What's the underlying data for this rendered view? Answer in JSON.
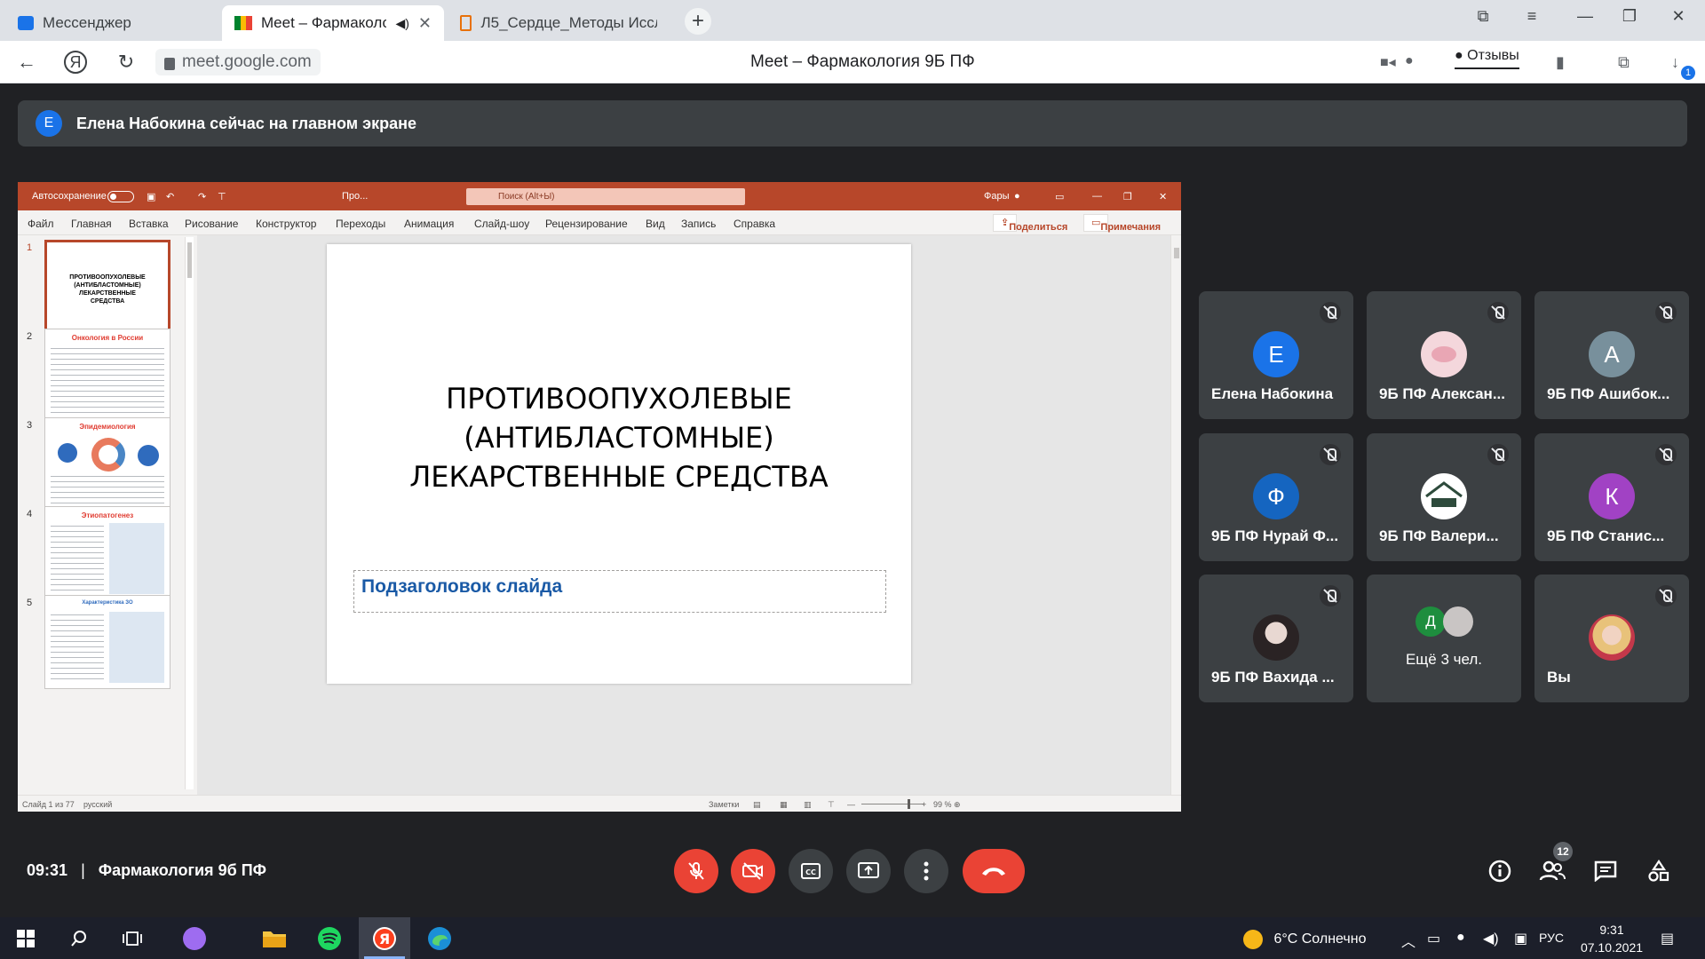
{
  "browser": {
    "tabs": [
      {
        "label": "Мессенджер"
      },
      {
        "label": "Meet – Фармакология 9Б ПФ"
      },
      {
        "label": "Л5_Сердце_Методы Иссле"
      }
    ],
    "url": "meet.google.com",
    "page_title": "Meet – Фармакология 9Б ПФ",
    "feedback_label": "Отзывы",
    "downloads_badge": "1"
  },
  "banner": {
    "avatar_letter": "Е",
    "text": "Елена Набокина сейчас на главном экране"
  },
  "presentation": {
    "app_bar": {
      "autosave": "Автосохранение",
      "file": "Про...",
      "search_placeholder": "Поиск (Alt+Ы)",
      "user": "Фары"
    },
    "menu": [
      "Файл",
      "Главная",
      "Вставка",
      "Рисование",
      "Конструктор",
      "Переходы",
      "Анимация",
      "Слайд-шоу",
      "Рецензирование",
      "Вид",
      "Запись",
      "Справка"
    ],
    "share_label": "Поделиться",
    "comments_label": "Примечания",
    "thumbnails": [
      {
        "num": "1",
        "text": "ПРОТИВООПУХОЛЕВЫЕ (АНТИБЛАСТОМНЫЕ) ЛЕКАРСТВЕННЫЕ СРЕДСТВА"
      },
      {
        "num": "2",
        "text": "Онкология в России"
      },
      {
        "num": "3",
        "text": "Эпидемиология"
      },
      {
        "num": "4",
        "text": "Этиопатогенез"
      },
      {
        "num": "5",
        "text": "Характеристика ЗО"
      }
    ],
    "slide": {
      "title": [
        "ПРОТИВООПУХОЛЕВЫЕ",
        "(АНТИБЛАСТОМНЫЕ)",
        "ЛЕКАРСТВЕННЫЕ СРЕДСТВА"
      ],
      "subtitle": "Подзаголовок слайда"
    },
    "status": {
      "slide_counter": "Слайд 1 из 77",
      "language": "русский",
      "notes": "Заметки",
      "zoom": "99 %"
    }
  },
  "participants": [
    {
      "name": "Елена Набокина",
      "letter": "Е",
      "color": "#1a73e8",
      "muted": true
    },
    {
      "name": "9Б ПФ Алексан...",
      "letter": "",
      "color": "#f4d7dc",
      "muted": true
    },
    {
      "name": "9Б ПФ Ашибок...",
      "letter": "А",
      "color": "#78909c",
      "muted": true
    },
    {
      "name": "9Б ПФ Нурай Ф...",
      "letter": "Ф",
      "color": "#1565c0",
      "muted": true
    },
    {
      "name": "9Б ПФ Валери...",
      "letter": "",
      "color": "#ffffff",
      "muted": true
    },
    {
      "name": "9Б ПФ Станис...",
      "letter": "К",
      "color": "#a142c4",
      "muted": true
    },
    {
      "name": "9Б ПФ Вахида ...",
      "letter": "",
      "color": "#b0a8ad",
      "muted": true
    },
    {
      "name": "Ещё 3 чел.",
      "letter": "Д",
      "color": "#1e8e3e",
      "muted": false
    },
    {
      "name": "Вы",
      "letter": "",
      "color": "#d88a6a",
      "muted": true
    }
  ],
  "meeting": {
    "time": "09:31",
    "name": "Фармакология 9б ПФ",
    "participant_count": "12"
  },
  "taskbar": {
    "weather": "6°C  Солнечно",
    "language": "РУС",
    "time": "9:31",
    "date": "07.10.2021"
  }
}
